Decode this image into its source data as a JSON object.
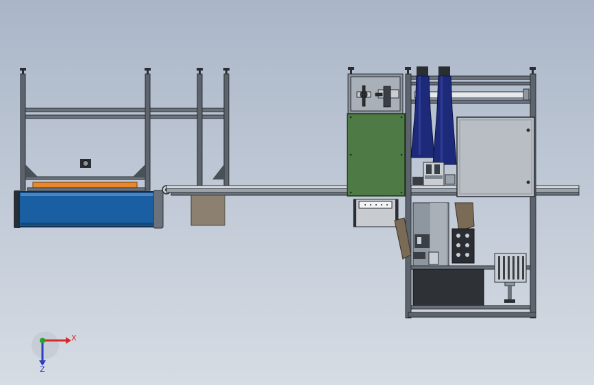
{
  "viewport": {
    "background_top": "#aab6c8",
    "background_bottom": "#d6dce4"
  },
  "colors": {
    "frame": "#3a3f46",
    "frame_light": "#9aa2ac",
    "blue_housing": "#1b5fa3",
    "orange_strip": "#e8882a",
    "green_panel": "#4e7a45",
    "navy_cylinder": "#1d2a7a",
    "gray_cabinet": "#b9bec4",
    "dark_block": "#2e3136",
    "tan_box": "#8c8170"
  },
  "triad": {
    "x_label": "X",
    "z_label": "Z",
    "x_color": "#d62828",
    "z_color": "#2b3fc4",
    "y_color": "#2aa02a"
  }
}
